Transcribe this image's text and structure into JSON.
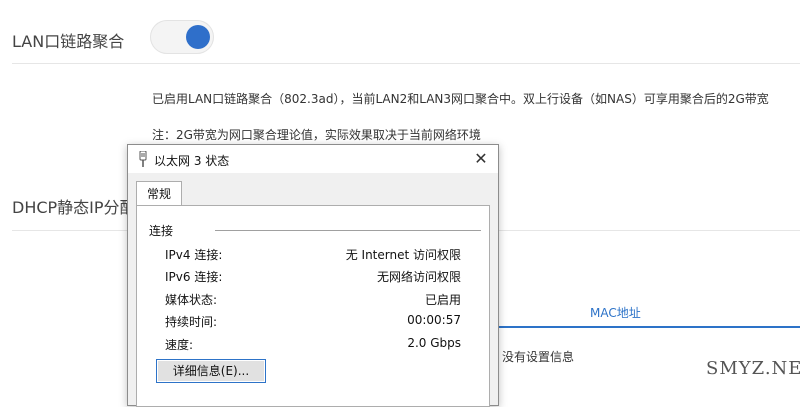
{
  "router": {
    "lag_title": "LAN口链路聚合",
    "lag_desc": "已启用LAN口链路聚合（802.3ad），当前LAN2和LAN3网口聚合中。双上行设备（如NAS）可享用聚合后的2G带宽",
    "lag_note": "注：2G带宽为网口聚合理论值，实际效果取决于当前网络环境",
    "dhcp_title": "DHCP静态IP分配",
    "mac_header": "MAC地址",
    "mac_empty": "没有设置信息",
    "accent_color": "#2d73c8",
    "toggle_on": true
  },
  "dialog": {
    "title": "以太网 3 状态",
    "title_icon": "network-adapter-icon",
    "close_icon": "close-icon",
    "tab": "常规",
    "group": "连接",
    "rows": [
      {
        "label": "IPv4 连接:",
        "value": "无 Internet 访问权限"
      },
      {
        "label": "IPv6 连接:",
        "value": "无网络访问权限"
      },
      {
        "label": "媒体状态:",
        "value": "已启用"
      },
      {
        "label": "持续时间:",
        "value": "00:00:57"
      },
      {
        "label": "速度:",
        "value": "2.0 Gbps"
      }
    ],
    "details_button": "详细信息(E)..."
  },
  "watermark": "SMYZ.NET"
}
